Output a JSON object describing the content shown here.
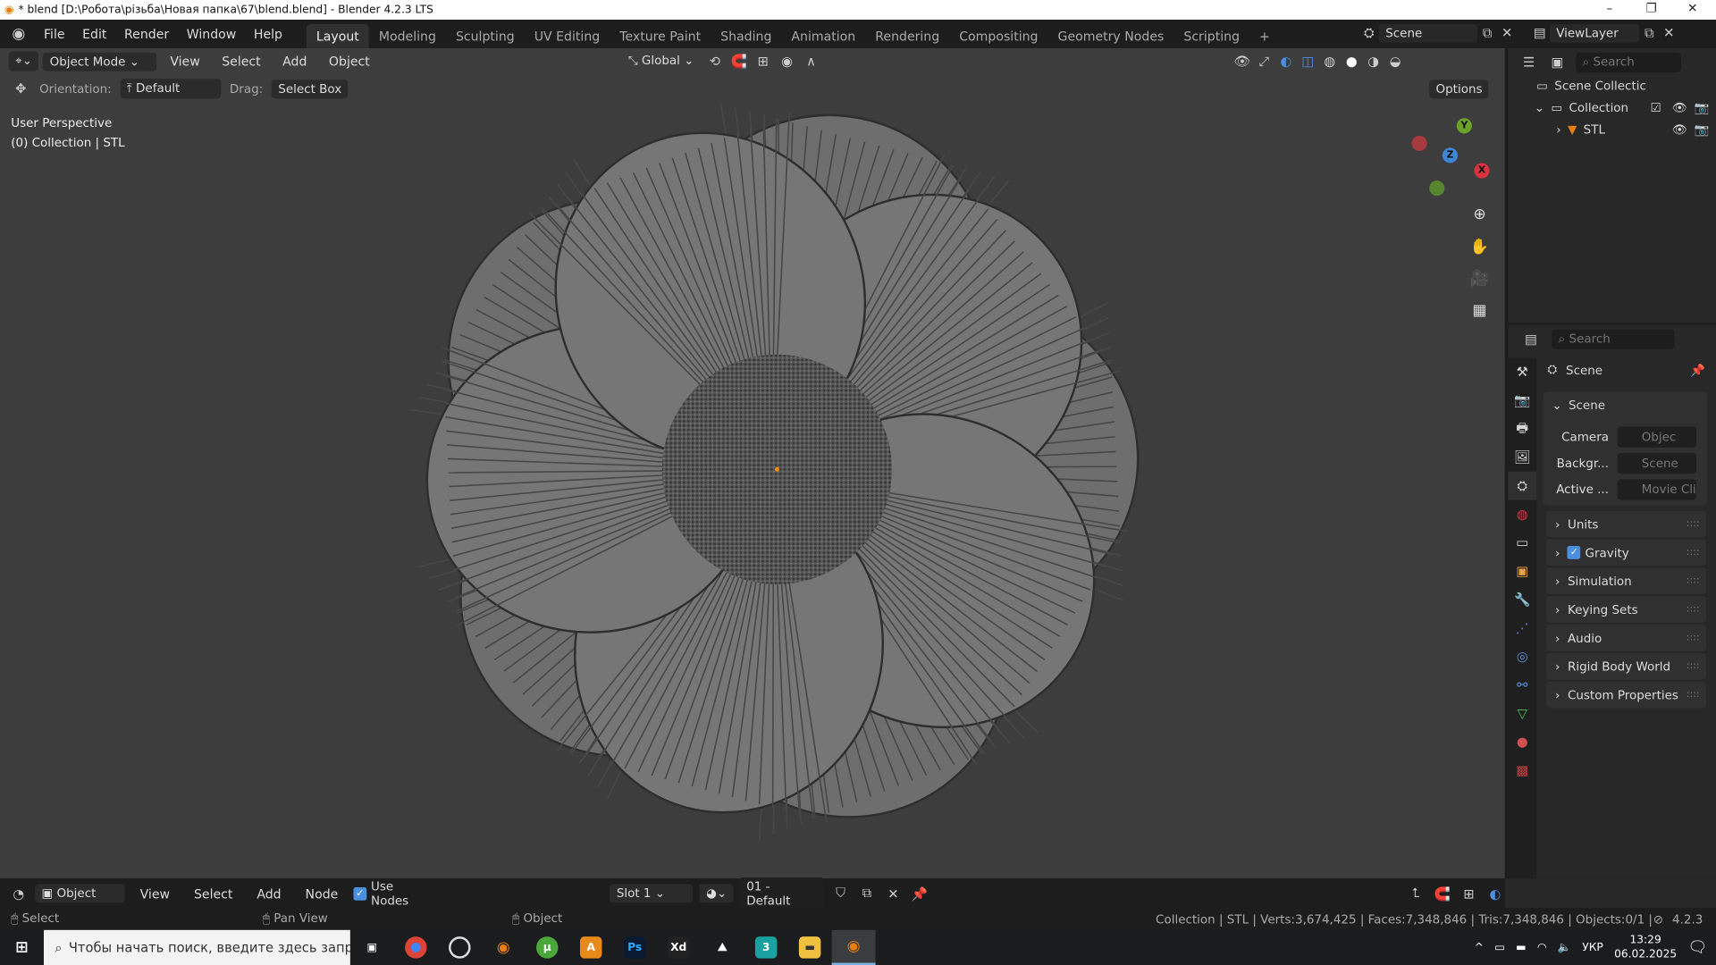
{
  "window": {
    "title": "* blend [D:\\Робота\\різьба\\Новая папка\\67\\blend.blend] - Blender 4.2.3 LTS",
    "minimize": "–",
    "restore": "❐",
    "close": "✕"
  },
  "menu": [
    "File",
    "Edit",
    "Render",
    "Window",
    "Help"
  ],
  "workspaces": [
    "Layout",
    "Modeling",
    "Sculpting",
    "UV Editing",
    "Texture Paint",
    "Shading",
    "Animation",
    "Rendering",
    "Compositing",
    "Geometry Nodes",
    "Scripting",
    "+"
  ],
  "scene_selector": "Scene",
  "viewlayer_selector": "ViewLayer",
  "viewport": {
    "mode": "Object Mode",
    "menus": [
      "View",
      "Select",
      "Add",
      "Object"
    ],
    "transform_orientation": "Global",
    "orientation_label": "Orientation:",
    "orientation_value": "Default",
    "drag_label": "Drag:",
    "drag_value": "Select Box",
    "options": "Options",
    "overlay_line1": "User Perspective",
    "overlay_line2": "(0) Collection | STL",
    "axes": {
      "x": "X",
      "y": "Y",
      "z": "Z"
    }
  },
  "outliner": {
    "search_placeholder": "Search",
    "items": [
      {
        "label": "Scene Collectic"
      },
      {
        "label": "Collection"
      },
      {
        "label": "STL"
      }
    ]
  },
  "properties": {
    "search_placeholder": "Search",
    "context": "Scene",
    "panel_scene": "Scene",
    "fields": [
      {
        "label": "Camera",
        "value": "Objec"
      },
      {
        "label": "Backgr...",
        "value": "Scene"
      },
      {
        "label": "Active ...",
        "value": "Movie Cli"
      }
    ],
    "panels": [
      "Units",
      "Gravity",
      "Simulation",
      "Keying Sets",
      "Audio",
      "Rigid Body World",
      "Custom Properties"
    ],
    "gravity_checked": true
  },
  "shader": {
    "editor": "Object",
    "menus": [
      "View",
      "Select",
      "Add",
      "Node"
    ],
    "use_nodes": "Use Nodes",
    "use_nodes_checked": true,
    "slot": "Slot 1",
    "material": "01 - Default"
  },
  "status": {
    "select": "Select",
    "pan": "Pan View",
    "object": "Object",
    "stats": "Collection | STL | Verts:3,674,425 | Faces:7,348,846 | Tris:7,348,846 | Objects:0/1 |",
    "version": "4.2.3"
  },
  "taskbar": {
    "search_placeholder": "Чтобы начать поиск, введите здесь запрос",
    "lang": "УКР",
    "time": "13:29",
    "date": "06.02.2025",
    "apps": [
      "Ps",
      "Xd",
      "3"
    ]
  }
}
